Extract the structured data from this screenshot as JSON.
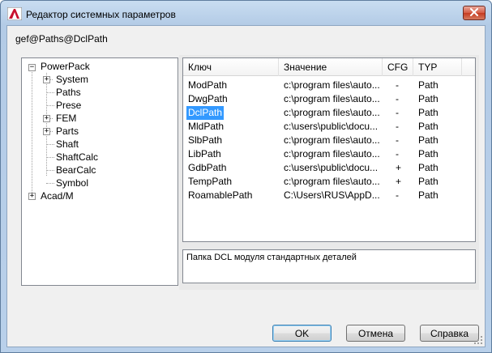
{
  "window": {
    "title": "Редактор системных параметров",
    "icon": "autocad-app-icon",
    "close_icon": "close-icon"
  },
  "path_label": "gef@Paths@DclPath",
  "tree": {
    "root1": {
      "label": "PowerPack",
      "expander": "−"
    },
    "children": [
      {
        "label": "System",
        "expander": "+"
      },
      {
        "label": "Paths",
        "expander": ""
      },
      {
        "label": "Prese",
        "expander": ""
      },
      {
        "label": "FEM",
        "expander": "+"
      },
      {
        "label": "Parts",
        "expander": "+"
      },
      {
        "label": "Shaft",
        "expander": ""
      },
      {
        "label": "ShaftCalc",
        "expander": ""
      },
      {
        "label": "BearCalc",
        "expander": ""
      },
      {
        "label": "Symbol",
        "expander": ""
      }
    ],
    "root2": {
      "label": "Acad/M",
      "expander": "+"
    }
  },
  "list": {
    "columns": [
      "Ключ",
      "Значение",
      "CFG",
      "TYP"
    ],
    "selected_index": 2,
    "rows": [
      {
        "key": "ModPath",
        "value": "c:\\program files\\auto...",
        "cfg": "-",
        "typ": "Path"
      },
      {
        "key": "DwgPath",
        "value": "c:\\program files\\auto...",
        "cfg": "-",
        "typ": "Path"
      },
      {
        "key": "DclPath",
        "value": "c:\\program files\\auto...",
        "cfg": "-",
        "typ": "Path"
      },
      {
        "key": "MldPath",
        "value": "c:\\users\\public\\docu...",
        "cfg": "-",
        "typ": "Path"
      },
      {
        "key": "SlbPath",
        "value": "c:\\program files\\auto...",
        "cfg": "-",
        "typ": "Path"
      },
      {
        "key": "LibPath",
        "value": "c:\\program files\\auto...",
        "cfg": "-",
        "typ": "Path"
      },
      {
        "key": "GdbPath",
        "value": "c:\\users\\public\\docu...",
        "cfg": "+",
        "typ": "Path"
      },
      {
        "key": "TempPath",
        "value": "c:\\program files\\auto...",
        "cfg": "+",
        "typ": "Path"
      },
      {
        "key": "RoamablePath",
        "value": "C:\\Users\\RUS\\AppD...",
        "cfg": "-",
        "typ": "Path"
      }
    ]
  },
  "description": "Папка DCL модуля стандартных деталей",
  "buttons": {
    "ok": "OK",
    "cancel": "Отмена",
    "help": "Справка"
  },
  "colors": {
    "selection": "#3399ff",
    "close_button": "#c53b21",
    "title_gradient": "#c9ddf1"
  }
}
